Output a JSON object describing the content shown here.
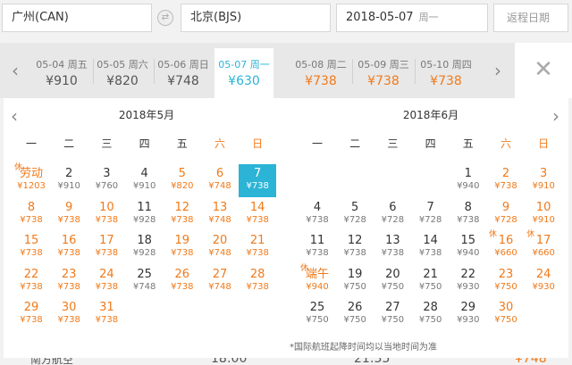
{
  "search": {
    "from": "广州(CAN)",
    "swap_icon": "⇄",
    "to": "北京(BJS)",
    "depart_date": "2018-05-07",
    "depart_weekday": "周一",
    "return_placeholder": "返程日期"
  },
  "strip": {
    "prev": "‹",
    "next": "›",
    "close": "✕",
    "items": [
      {
        "date": "05-04 周五",
        "price": "¥910",
        "state": "normal"
      },
      {
        "date": "05-05 周六",
        "price": "¥820",
        "state": "normal"
      },
      {
        "date": "05-06 周日",
        "price": "¥748",
        "state": "normal"
      },
      {
        "date": "05-07 周一",
        "price": "¥630",
        "state": "selected"
      },
      {
        "date": "05-08 周二",
        "price": "¥738",
        "state": "orange"
      },
      {
        "date": "05-09 周三",
        "price": "¥738",
        "state": "orange"
      },
      {
        "date": "05-10 周四",
        "price": "¥738",
        "state": "orange"
      }
    ]
  },
  "calendar": {
    "prev": "‹",
    "next": "›",
    "weekdays": [
      "一",
      "二",
      "三",
      "四",
      "五",
      "六",
      "日"
    ],
    "note": "*国际航班起降时间均以当地时间为准",
    "months": [
      {
        "title": "2018年5月",
        "first_col": 1,
        "days": [
          {
            "n": "劳动",
            "p": "¥1203",
            "hol": "休",
            "o": true
          },
          {
            "n": "2",
            "p": "¥910"
          },
          {
            "n": "3",
            "p": "¥760"
          },
          {
            "n": "4",
            "p": "¥910"
          },
          {
            "n": "5",
            "p": "¥820",
            "o": true
          },
          {
            "n": "6",
            "p": "¥748",
            "o": true
          },
          {
            "n": "7",
            "p": "¥738",
            "sel": true
          },
          {
            "n": "8",
            "p": "¥738",
            "o": true
          },
          {
            "n": "9",
            "p": "¥738",
            "o": true
          },
          {
            "n": "10",
            "p": "¥738",
            "o": true
          },
          {
            "n": "11",
            "p": "¥928"
          },
          {
            "n": "12",
            "p": "¥738",
            "o": true
          },
          {
            "n": "13",
            "p": "¥748",
            "o": true
          },
          {
            "n": "14",
            "p": "¥738",
            "o": true
          },
          {
            "n": "15",
            "p": "¥738",
            "o": true
          },
          {
            "n": "16",
            "p": "¥738",
            "o": true
          },
          {
            "n": "17",
            "p": "¥738",
            "o": true
          },
          {
            "n": "18",
            "p": "¥928"
          },
          {
            "n": "19",
            "p": "¥738",
            "o": true
          },
          {
            "n": "20",
            "p": "¥748",
            "o": true
          },
          {
            "n": "21",
            "p": "¥738",
            "o": true
          },
          {
            "n": "22",
            "p": "¥738",
            "o": true
          },
          {
            "n": "23",
            "p": "¥738",
            "o": true
          },
          {
            "n": "24",
            "p": "¥738",
            "o": true
          },
          {
            "n": "25",
            "p": "¥748"
          },
          {
            "n": "26",
            "p": "¥738",
            "o": true
          },
          {
            "n": "27",
            "p": "¥748",
            "o": true
          },
          {
            "n": "28",
            "p": "¥738",
            "o": true
          },
          {
            "n": "29",
            "p": "¥738",
            "o": true
          },
          {
            "n": "30",
            "p": "¥738",
            "o": true
          },
          {
            "n": "31",
            "p": "¥738",
            "o": true
          }
        ]
      },
      {
        "title": "2018年6月",
        "first_col": 5,
        "days": [
          {
            "n": "1",
            "p": "¥940"
          },
          {
            "n": "2",
            "p": "¥738",
            "o": true
          },
          {
            "n": "3",
            "p": "¥910",
            "o": true
          },
          {
            "n": "4",
            "p": "¥738"
          },
          {
            "n": "5",
            "p": "¥728"
          },
          {
            "n": "6",
            "p": "¥728"
          },
          {
            "n": "7",
            "p": "¥728"
          },
          {
            "n": "8",
            "p": "¥738"
          },
          {
            "n": "9",
            "p": "¥728",
            "o": true
          },
          {
            "n": "10",
            "p": "¥910",
            "o": true
          },
          {
            "n": "11",
            "p": "¥738"
          },
          {
            "n": "12",
            "p": "¥738"
          },
          {
            "n": "13",
            "p": "¥738"
          },
          {
            "n": "14",
            "p": "¥738"
          },
          {
            "n": "15",
            "p": "¥940"
          },
          {
            "n": "16",
            "p": "¥660",
            "hol": "休",
            "o": true
          },
          {
            "n": "17",
            "p": "¥660",
            "hol": "休",
            "o": true
          },
          {
            "n": "端午",
            "p": "¥940",
            "hol": "休",
            "o": true
          },
          {
            "n": "19",
            "p": "¥750"
          },
          {
            "n": "20",
            "p": "¥750"
          },
          {
            "n": "21",
            "p": "¥750"
          },
          {
            "n": "22",
            "p": "¥930"
          },
          {
            "n": "23",
            "p": "¥750",
            "o": true
          },
          {
            "n": "24",
            "p": "¥930",
            "o": true
          },
          {
            "n": "25",
            "p": "¥750"
          },
          {
            "n": "26",
            "p": "¥750"
          },
          {
            "n": "27",
            "p": "¥750"
          },
          {
            "n": "28",
            "p": "¥750"
          },
          {
            "n": "29",
            "p": "¥930"
          },
          {
            "n": "30",
            "p": "¥750",
            "o": true
          }
        ]
      }
    ]
  },
  "peek": {
    "airline": "南方航空",
    "dep": "18:00",
    "arr": "21:35",
    "price": "¥748"
  }
}
